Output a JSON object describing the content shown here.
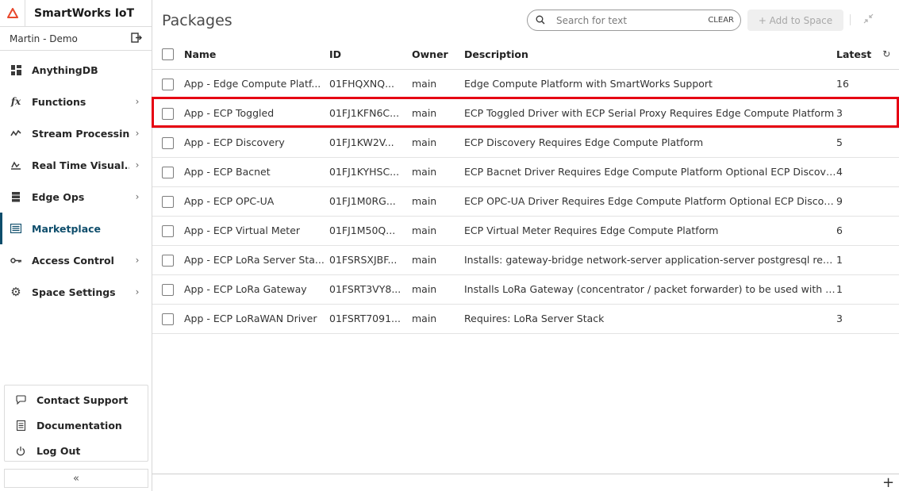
{
  "app": {
    "title": "SmartWorks IoT",
    "user": "Martin - Demo"
  },
  "sidebar": {
    "items": [
      {
        "label": "AnythingDB",
        "icon": "database-icon",
        "chevron": false,
        "active": false
      },
      {
        "label": "Functions",
        "icon": "function-icon",
        "chevron": true,
        "active": false
      },
      {
        "label": "Stream Processing",
        "icon": "stream-icon",
        "chevron": true,
        "active": false
      },
      {
        "label": "Real Time Visual...",
        "icon": "chart-icon",
        "chevron": true,
        "active": false
      },
      {
        "label": "Edge Ops",
        "icon": "server-icon",
        "chevron": true,
        "active": false
      },
      {
        "label": "Marketplace",
        "icon": "marketplace-icon",
        "chevron": false,
        "active": true
      },
      {
        "label": "Access Control",
        "icon": "key-icon",
        "chevron": true,
        "active": false
      },
      {
        "label": "Space Settings",
        "icon": "gear-icon",
        "chevron": true,
        "active": false
      }
    ],
    "bottom": [
      {
        "label": "Contact Support",
        "icon": "chat-icon"
      },
      {
        "label": "Documentation",
        "icon": "document-icon"
      },
      {
        "label": "Log Out",
        "icon": "power-icon"
      }
    ],
    "collapse_label": "«"
  },
  "header": {
    "title": "Packages",
    "search_placeholder": "Search for text",
    "clear_label": "CLEAR",
    "add_label": "+ Add to Space"
  },
  "table": {
    "columns": {
      "name": "Name",
      "id": "ID",
      "owner": "Owner",
      "description": "Description",
      "latest": "Latest"
    },
    "rows": [
      {
        "name": "App - Edge Compute Platf...",
        "id": "01FHQXNQ...",
        "owner": "main",
        "description": "Edge Compute Platform with SmartWorks Support",
        "latest": "16"
      },
      {
        "name": "App - ECP Toggled",
        "id": "01FJ1KFN6C...",
        "owner": "main",
        "description": "ECP Toggled Driver with ECP Serial Proxy Requires Edge Compute Platform",
        "latest": "3"
      },
      {
        "name": "App - ECP Discovery",
        "id": "01FJ1KW2V...",
        "owner": "main",
        "description": "ECP Discovery Requires Edge Compute Platform",
        "latest": "5"
      },
      {
        "name": "App - ECP Bacnet",
        "id": "01FJ1KYHSC...",
        "owner": "main",
        "description": "ECP Bacnet Driver Requires Edge Compute Platform Optional ECP Discovery",
        "latest": "4"
      },
      {
        "name": "App - ECP OPC-UA",
        "id": "01FJ1M0RG...",
        "owner": "main",
        "description": "ECP OPC-UA Driver Requires Edge Compute Platform Optional ECP Discovery",
        "latest": "9"
      },
      {
        "name": "App - ECP Virtual Meter",
        "id": "01FJ1M50Q...",
        "owner": "main",
        "description": "ECP Virtual Meter Requires Edge Compute Platform",
        "latest": "6"
      },
      {
        "name": "App - ECP LoRa Server Sta...",
        "id": "01FSRSXJBF...",
        "owner": "main",
        "description": "Installs: gateway-bridge network-server application-server postgresql redis ...",
        "latest": "1"
      },
      {
        "name": "App - ECP LoRa Gateway",
        "id": "01FSRT3VY8...",
        "owner": "main",
        "description": "Installs LoRa Gateway (concentrator / packet forwarder) to be used with LoR...",
        "latest": "1"
      },
      {
        "name": "App - ECP LoRaWAN Driver",
        "id": "01FSRT7091...",
        "owner": "main",
        "description": "Requires: LoRa Server Stack",
        "latest": "3"
      }
    ],
    "highlighted_row": 1
  },
  "colors": {
    "accent": "#0e4d6b",
    "highlight": "#e60012",
    "logo": "#e8482c"
  }
}
